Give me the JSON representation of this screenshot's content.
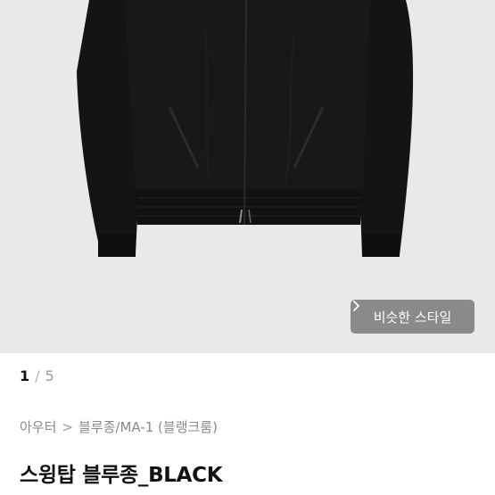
{
  "gallery": {
    "similar_style_label": "비슷한 스타일",
    "current_page": "1",
    "separator": "/",
    "total_pages": "5"
  },
  "breadcrumb": {
    "items": [
      "아우터",
      "블루종/MA-1 (블랭크룸)"
    ],
    "separator": ">"
  },
  "product": {
    "title": "스윙탑 블루종_BLACK"
  },
  "icons": {
    "similar_style_arrow": "chevron-right-icon"
  },
  "colors": {
    "photo_background": "#e9e9e7",
    "jacket": "#121212",
    "button_overlay": "rgba(112,112,112,0.78)"
  }
}
